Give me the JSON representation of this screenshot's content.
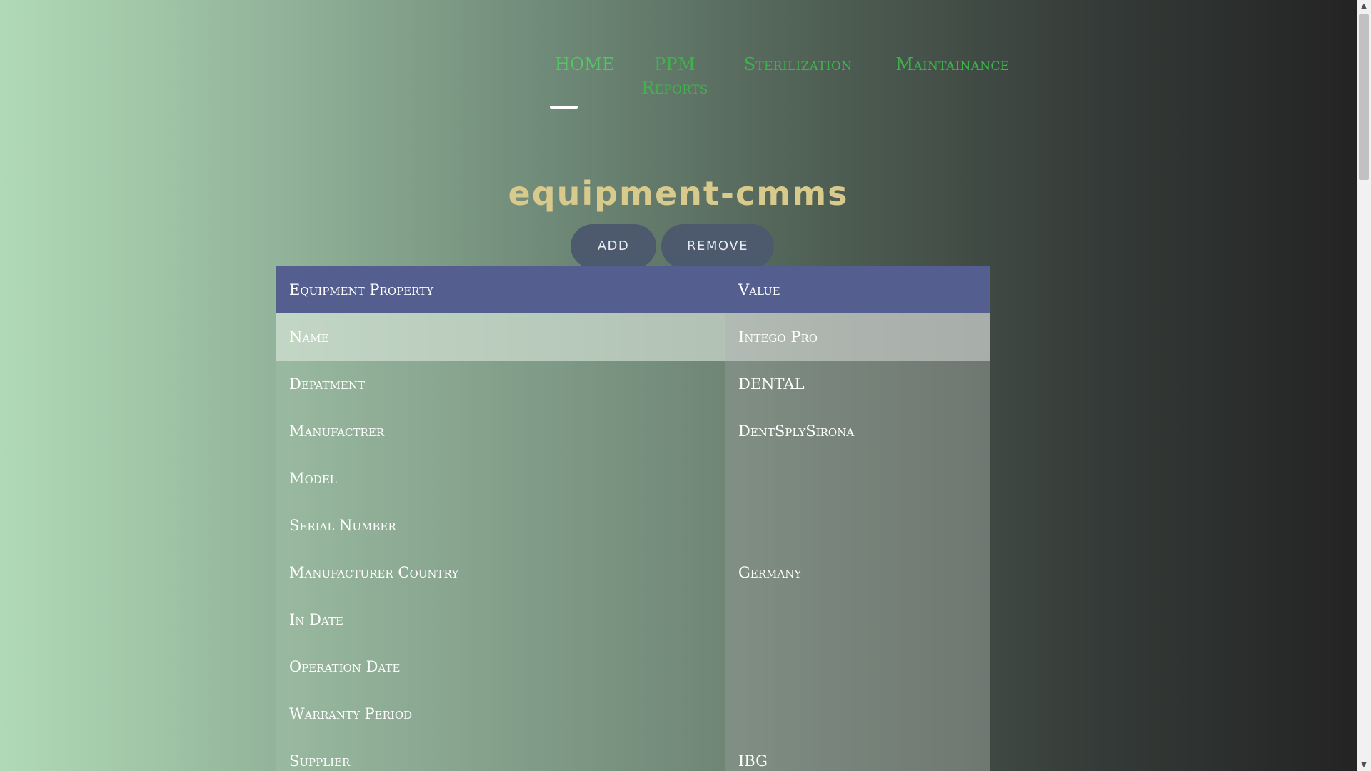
{
  "nav": {
    "items": [
      {
        "label": "HOME"
      },
      {
        "label": "PPM Reports"
      },
      {
        "label": "Sterilization"
      },
      {
        "label": "Maintainance"
      }
    ]
  },
  "page_title": "equipment-cmms",
  "buttons": {
    "add_label": "ADD",
    "remove_label": "REMOVE"
  },
  "table": {
    "headers": [
      "Equipment Property",
      "Value"
    ],
    "rows": [
      {
        "property": "Name",
        "value": "Intego Pro"
      },
      {
        "property": "Depatment",
        "value": "DENTAL"
      },
      {
        "property": "Manufactrer",
        "value": "DentSplySirona"
      },
      {
        "property": "Model",
        "value": ""
      },
      {
        "property": "Serial Number",
        "value": ""
      },
      {
        "property": "Manufacturer Country",
        "value": "Germany"
      },
      {
        "property": "In Date",
        "value": ""
      },
      {
        "property": "Operation Date",
        "value": ""
      },
      {
        "property": "Warranty Period",
        "value": ""
      },
      {
        "property": "Supplier",
        "value": "IBG"
      }
    ]
  },
  "colors": {
    "nav_text": "#3cb54a",
    "title": "#d8c98c",
    "button_bg": "#4d5a6e",
    "table_header_bg": "#545e8f"
  },
  "icons": {
    "scroll_up": "scroll-up-arrow-icon",
    "scroll_down": "scroll-down-arrow-icon"
  }
}
